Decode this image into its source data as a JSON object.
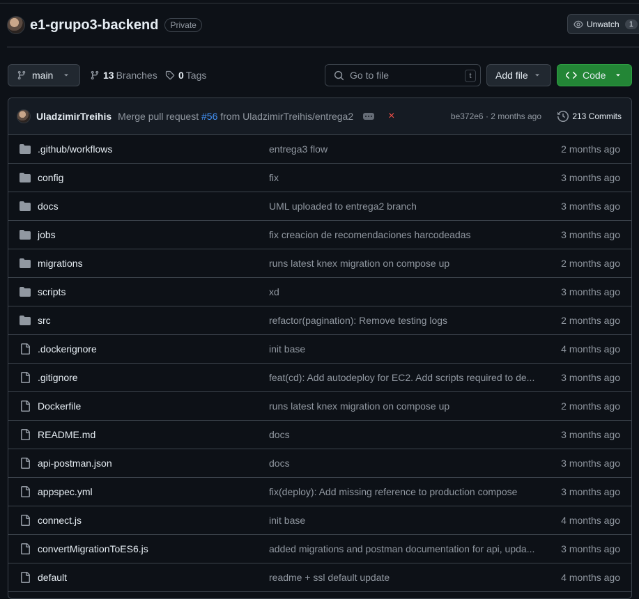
{
  "repo": {
    "name": "e1-grupo3-backend",
    "visibility": "Private",
    "watch_label": "Unwatch",
    "watch_count": "1"
  },
  "toolbar": {
    "branch": "main",
    "branches_count": "13",
    "branches_label": "Branches",
    "tags_count": "0",
    "tags_label": "Tags",
    "goto_placeholder": "Go to file",
    "goto_shortcut": "t",
    "add_file_label": "Add file",
    "code_label": "Code"
  },
  "latest_commit": {
    "author": "UladzimirTreihis",
    "message_prefix": "Merge pull request",
    "pr_link": "#56",
    "message_suffix": "from UladzimirTreihis/entrega2",
    "status": "×",
    "sha_time": "be372e6 · 2 months ago",
    "commits_label": "213 Commits"
  },
  "files": [
    {
      "type": "dir",
      "name": ".github/workflows",
      "message": "entrega3 flow",
      "age": "2 months ago"
    },
    {
      "type": "dir",
      "name": "config",
      "message": "fix",
      "age": "3 months ago"
    },
    {
      "type": "dir",
      "name": "docs",
      "message": "UML uploaded to entrega2 branch",
      "age": "3 months ago"
    },
    {
      "type": "dir",
      "name": "jobs",
      "message": "fix creacion de recomendaciones harcodeadas",
      "age": "3 months ago"
    },
    {
      "type": "dir",
      "name": "migrations",
      "message": "runs latest knex migration on compose up",
      "age": "2 months ago"
    },
    {
      "type": "dir",
      "name": "scripts",
      "message": "xd",
      "age": "3 months ago"
    },
    {
      "type": "dir",
      "name": "src",
      "message": "refactor(pagination): Remove testing logs",
      "age": "2 months ago"
    },
    {
      "type": "file",
      "name": ".dockerignore",
      "message": "init base",
      "age": "4 months ago"
    },
    {
      "type": "file",
      "name": ".gitignore",
      "message": "feat(cd): Add autodeploy for EC2. Add scripts required to de...",
      "age": "3 months ago"
    },
    {
      "type": "file",
      "name": "Dockerfile",
      "message": "runs latest knex migration on compose up",
      "age": "2 months ago"
    },
    {
      "type": "file",
      "name": "README.md",
      "message": "docs",
      "age": "3 months ago"
    },
    {
      "type": "file",
      "name": "api-postman.json",
      "message": "docs",
      "age": "3 months ago"
    },
    {
      "type": "file",
      "name": "appspec.yml",
      "message": "fix(deploy): Add missing reference to production compose",
      "age": "3 months ago"
    },
    {
      "type": "file",
      "name": "connect.js",
      "message": "init base",
      "age": "4 months ago"
    },
    {
      "type": "file",
      "name": "convertMigrationToES6.js",
      "message": "added migrations and postman documentation for api, upda...",
      "age": "3 months ago"
    },
    {
      "type": "file",
      "name": "default",
      "message": "readme + ssl default update",
      "age": "4 months ago"
    }
  ]
}
